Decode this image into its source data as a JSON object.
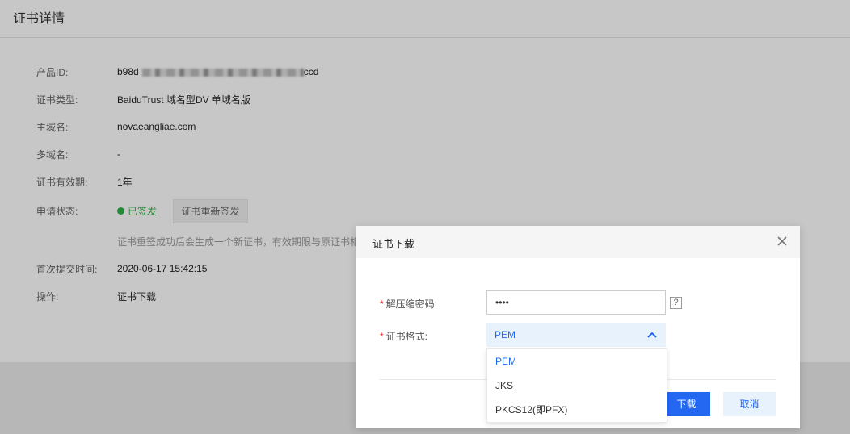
{
  "header": {
    "title": "证书详情"
  },
  "details": {
    "product_id": {
      "label": "产品ID:",
      "value": "b98d",
      "value_suffix": "ccd"
    },
    "cert_type": {
      "label": "证书类型:",
      "value": "BaiduTrust 域名型DV 单域名版"
    },
    "main_domain": {
      "label": "主域名:",
      "value": "novaeangliae.com"
    },
    "multi_domain": {
      "label": "多域名:",
      "value": "-"
    },
    "validity": {
      "label": "证书有效期:",
      "value": "1年"
    },
    "status": {
      "label": "申请状态:",
      "value": "已签发",
      "reissue_button": "证书重新签发"
    },
    "note": "证书重签成功后会生成一个新证书，有效期限与原证书相",
    "submit_time": {
      "label": "首次提交时间:",
      "value": "2020-06-17 15:42:15"
    },
    "actions": {
      "label": "操作:",
      "link": "证书下载"
    }
  },
  "dialog": {
    "title": "证书下载",
    "password": {
      "label": "解压缩密码:",
      "value": "••••",
      "help": "?"
    },
    "format": {
      "label": "证书格式:",
      "selected": "PEM",
      "options": [
        "PEM",
        "JKS",
        "PKCS12(即PFX)"
      ]
    },
    "download_button": "下载",
    "cancel_button": "取消"
  },
  "colors": {
    "accent": "#2468f2",
    "success": "#2cb145",
    "required": "#ea2e2e"
  },
  "icons": {
    "close": "close-icon",
    "chevron": "chevron-up-icon",
    "status": "status-dot-icon"
  }
}
